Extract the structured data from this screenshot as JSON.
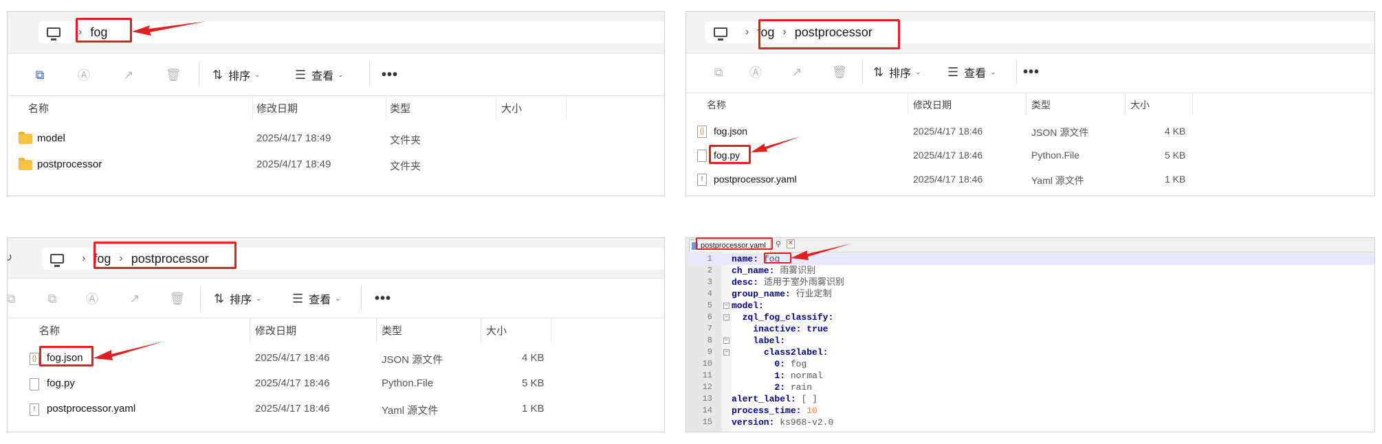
{
  "colors": {
    "accent_red": "#e02020",
    "folder": "#f5c542",
    "keyword": "#000080",
    "number": "#f08040"
  },
  "toolbar": {
    "sort_label": "排序",
    "view_label": "查看",
    "more_label": "•••"
  },
  "columns": {
    "name": "名称",
    "modified": "修改日期",
    "type": "类型",
    "size": "大小"
  },
  "panel1": {
    "breadcrumb": [
      "fog"
    ],
    "rows": [
      {
        "name": "model",
        "date": "2025/4/17 18:49",
        "type": "文件夹",
        "size": "",
        "icon": "folder-icon"
      },
      {
        "name": "postprocessor",
        "date": "2025/4/17 18:49",
        "type": "文件夹",
        "size": "",
        "icon": "folder-icon"
      }
    ]
  },
  "panel2": {
    "breadcrumb": [
      "fog",
      "postprocessor"
    ],
    "rows": [
      {
        "name": "fog.json",
        "date": "2025/4/17 18:46",
        "type": "JSON 源文件",
        "size": "4 KB",
        "icon": "json-file-icon"
      },
      {
        "name": "fog.py",
        "date": "2025/4/17 18:46",
        "type": "Python.File",
        "size": "5 KB",
        "icon": "file-icon"
      },
      {
        "name": "postprocessor.yaml",
        "date": "2025/4/17 18:46",
        "type": "Yaml 源文件",
        "size": "1 KB",
        "icon": "yaml-file-icon"
      }
    ]
  },
  "panel3": {
    "breadcrumb": [
      "fog",
      "postprocessor"
    ],
    "rows": [
      {
        "name": "fog.json",
        "date": "2025/4/17 18:46",
        "type": "JSON 源文件",
        "size": "4 KB",
        "icon": "json-file-icon"
      },
      {
        "name": "fog.py",
        "date": "2025/4/17 18:46",
        "type": "Python.File",
        "size": "5 KB",
        "icon": "file-icon"
      },
      {
        "name": "postprocessor.yaml",
        "date": "2025/4/17 18:46",
        "type": "Yaml 源文件",
        "size": "1 KB",
        "icon": "yaml-file-icon"
      }
    ]
  },
  "editor": {
    "tab_name": "postprocessor.yaml",
    "lines": [
      {
        "n": "1",
        "key": "name",
        "val": "fog",
        "indent": ""
      },
      {
        "n": "2",
        "key": "ch_name",
        "val": "雨雾识别",
        "indent": ""
      },
      {
        "n": "3",
        "key": "desc",
        "val": "适用于室外雨雾识别",
        "indent": ""
      },
      {
        "n": "4",
        "key": "group_name",
        "val": "行业定制",
        "indent": ""
      },
      {
        "n": "5",
        "key": "model",
        "val": "",
        "indent": ""
      },
      {
        "n": "6",
        "key": "zql_fog_classify",
        "val": "",
        "indent": "  "
      },
      {
        "n": "7",
        "key": "inactive",
        "val": "true",
        "indent": "    "
      },
      {
        "n": "8",
        "key": "label",
        "val": "",
        "indent": "    "
      },
      {
        "n": "9",
        "key": "class2label",
        "val": "",
        "indent": "      "
      },
      {
        "n": "10",
        "key": "0",
        "val": "fog",
        "indent": "        "
      },
      {
        "n": "11",
        "key": "1",
        "val": "normal",
        "indent": "        "
      },
      {
        "n": "12",
        "key": "2",
        "val": "rain",
        "indent": "        "
      },
      {
        "n": "13",
        "key": "alert_label",
        "val": "[ ]",
        "indent": ""
      },
      {
        "n": "14",
        "key": "process_time",
        "val": "10",
        "indent": ""
      },
      {
        "n": "15",
        "key": "version",
        "val": "ks968-v2.0",
        "indent": ""
      }
    ]
  }
}
